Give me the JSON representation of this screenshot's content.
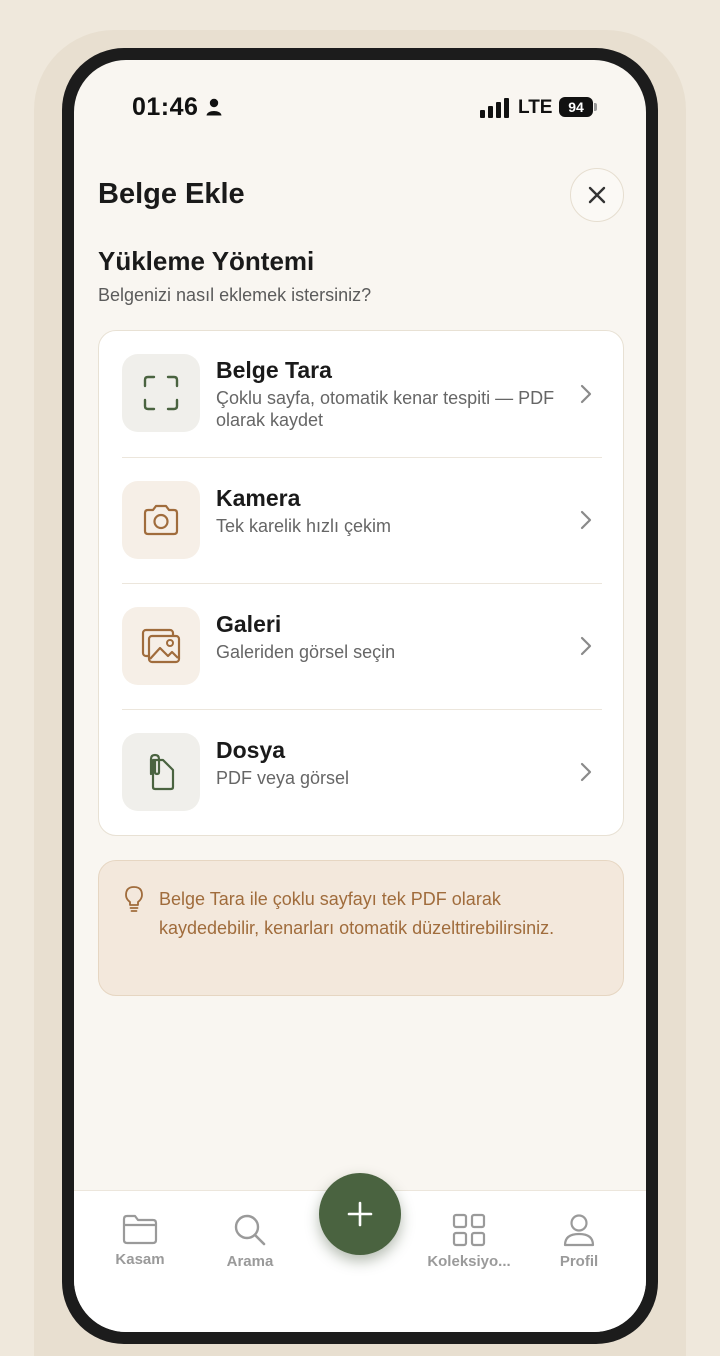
{
  "status_bar": {
    "time": "01:46",
    "network": "LTE",
    "battery": "94"
  },
  "header": {
    "title": "Belge Ekle"
  },
  "section": {
    "title": "Yükleme Yöntemi",
    "subtitle": "Belgenizi nasıl eklemek istersiniz?"
  },
  "options": [
    {
      "title": "Belge Tara",
      "description": "Çoklu sayfa, otomatik kenar tespiti — PDF olarak kaydet",
      "icon": "scan-icon"
    },
    {
      "title": "Kamera",
      "description": "Tek karelik hızlı çekim",
      "icon": "camera-icon"
    },
    {
      "title": "Galeri",
      "description": "Galeriden görsel seçin",
      "icon": "gallery-icon"
    },
    {
      "title": "Dosya",
      "description": "PDF veya görsel",
      "icon": "file-icon"
    }
  ],
  "tip": {
    "text": "Belge Tara ile çoklu sayfayı tek PDF olarak kaydedebilir, kenarları otomatik düzelttirebilirsiniz.",
    "icon": "lightbulb-icon"
  },
  "tabbar": {
    "items": [
      {
        "label": "Kasam",
        "icon": "folder-icon"
      },
      {
        "label": "Arama",
        "icon": "search-icon"
      },
      {
        "label": "Koleksiyo...",
        "icon": "grid-icon"
      },
      {
        "label": "Profil",
        "icon": "user-icon"
      }
    ],
    "fab_icon": "plus-icon"
  },
  "colors": {
    "accent_green": "#4a6340",
    "accent_brown": "#a06c3c",
    "background": "#f9f6f1"
  }
}
